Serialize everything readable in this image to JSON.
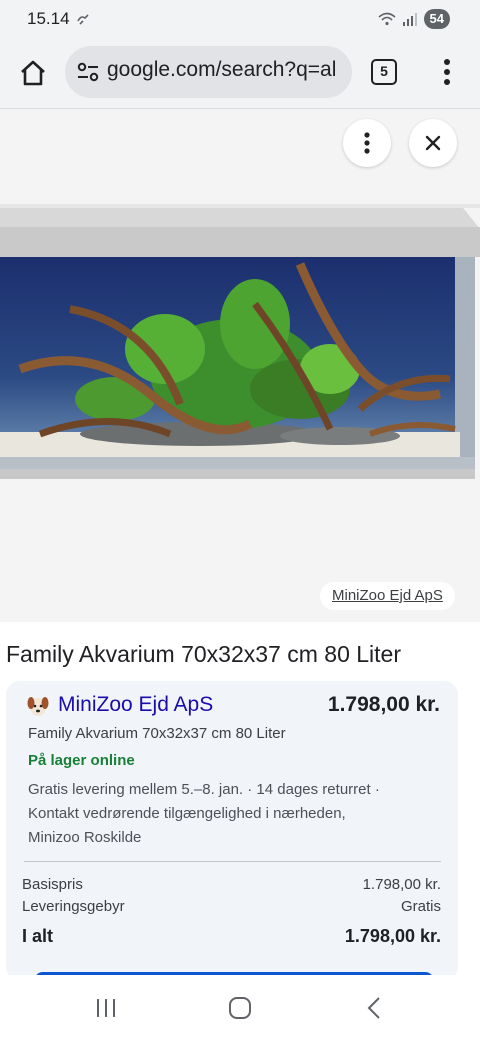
{
  "status_bar": {
    "time": "15.14",
    "battery": "54",
    "icons": [
      "sync-icon",
      "wifi-icon",
      "signal-icon",
      "battery-icon"
    ]
  },
  "browser": {
    "url": "google.com/search?q=al",
    "tab_count": "5",
    "icons": [
      "home-icon",
      "site-settings-icon",
      "tabs-icon",
      "more-vert-icon"
    ]
  },
  "image_viewer": {
    "source_label": "MiniZoo Ejd ApS",
    "icons": [
      "more-vert-icon",
      "close-icon"
    ]
  },
  "product": {
    "title": "Family Akvarium 70x32x37 cm 80 Liter"
  },
  "offer": {
    "store_name": "MiniZoo Ejd ApS",
    "price": "1.798,00 kr.",
    "description": "Family Akvarium 70x32x37 cm 80 Liter",
    "stock": "På lager online",
    "shipping": "Gratis levering mellem 5.–8. jan. · 14 dages returret · Kontakt vedrørende tilgængelighed i nærheden, Minizoo Roskilde",
    "breakdown": [
      {
        "label": "Basispris",
        "value": "1.798,00 kr."
      },
      {
        "label": "Leveringsgebyr",
        "value": "Gratis"
      },
      {
        "label": "I alt",
        "value": "1.798,00 kr."
      }
    ]
  },
  "colors": {
    "link_blue": "#1a0dab",
    "stock_green": "#188038",
    "button_blue": "#0b57d0",
    "card_bg": "#f1f4f9"
  }
}
